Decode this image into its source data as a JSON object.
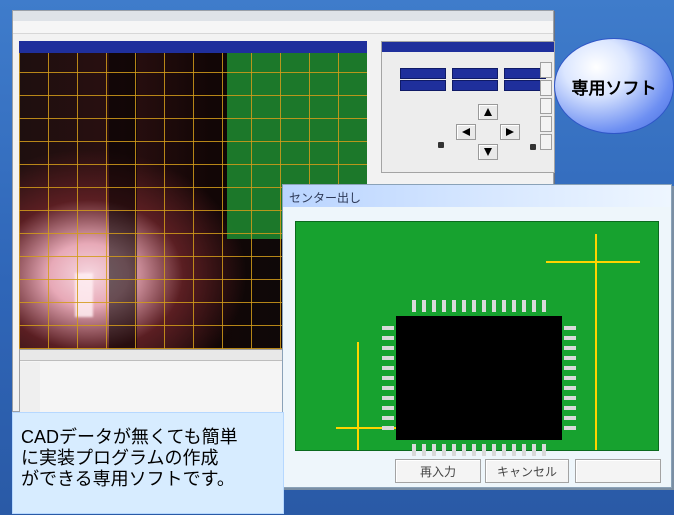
{
  "main_window": {
    "header_left": "",
    "header_right": "",
    "menu": [
      "",
      "",
      "",
      "",
      ""
    ]
  },
  "control_panel": {
    "title": "",
    "coord_title": "",
    "labels_left": [
      "",
      "",
      "",
      ""
    ],
    "bottom_labels": [
      "",
      ""
    ]
  },
  "data_table": {
    "headers": [
      "",
      "",
      "",
      "",
      ""
    ]
  },
  "dialog": {
    "title": "センター出し",
    "buttons": [
      "再入力",
      "キャンセル",
      ""
    ]
  },
  "badge": {
    "label": "専用ソフト"
  },
  "description": {
    "text": "CADデータが無くても簡単\nに実装プログラムの作成\nができる専用ソフトです。"
  },
  "colors": {
    "background": "#2f66b8",
    "pcb_green": "#17a22f",
    "camera_grid": "#d29b1a",
    "crosshair": "#ffd400",
    "badge_blue": "#4c72e6",
    "description_bg": "#d7ecff"
  },
  "icons": {
    "arrows": [
      "arrow-up-icon",
      "arrow-left-icon",
      "arrow-right-icon",
      "arrow-down-icon"
    ]
  }
}
